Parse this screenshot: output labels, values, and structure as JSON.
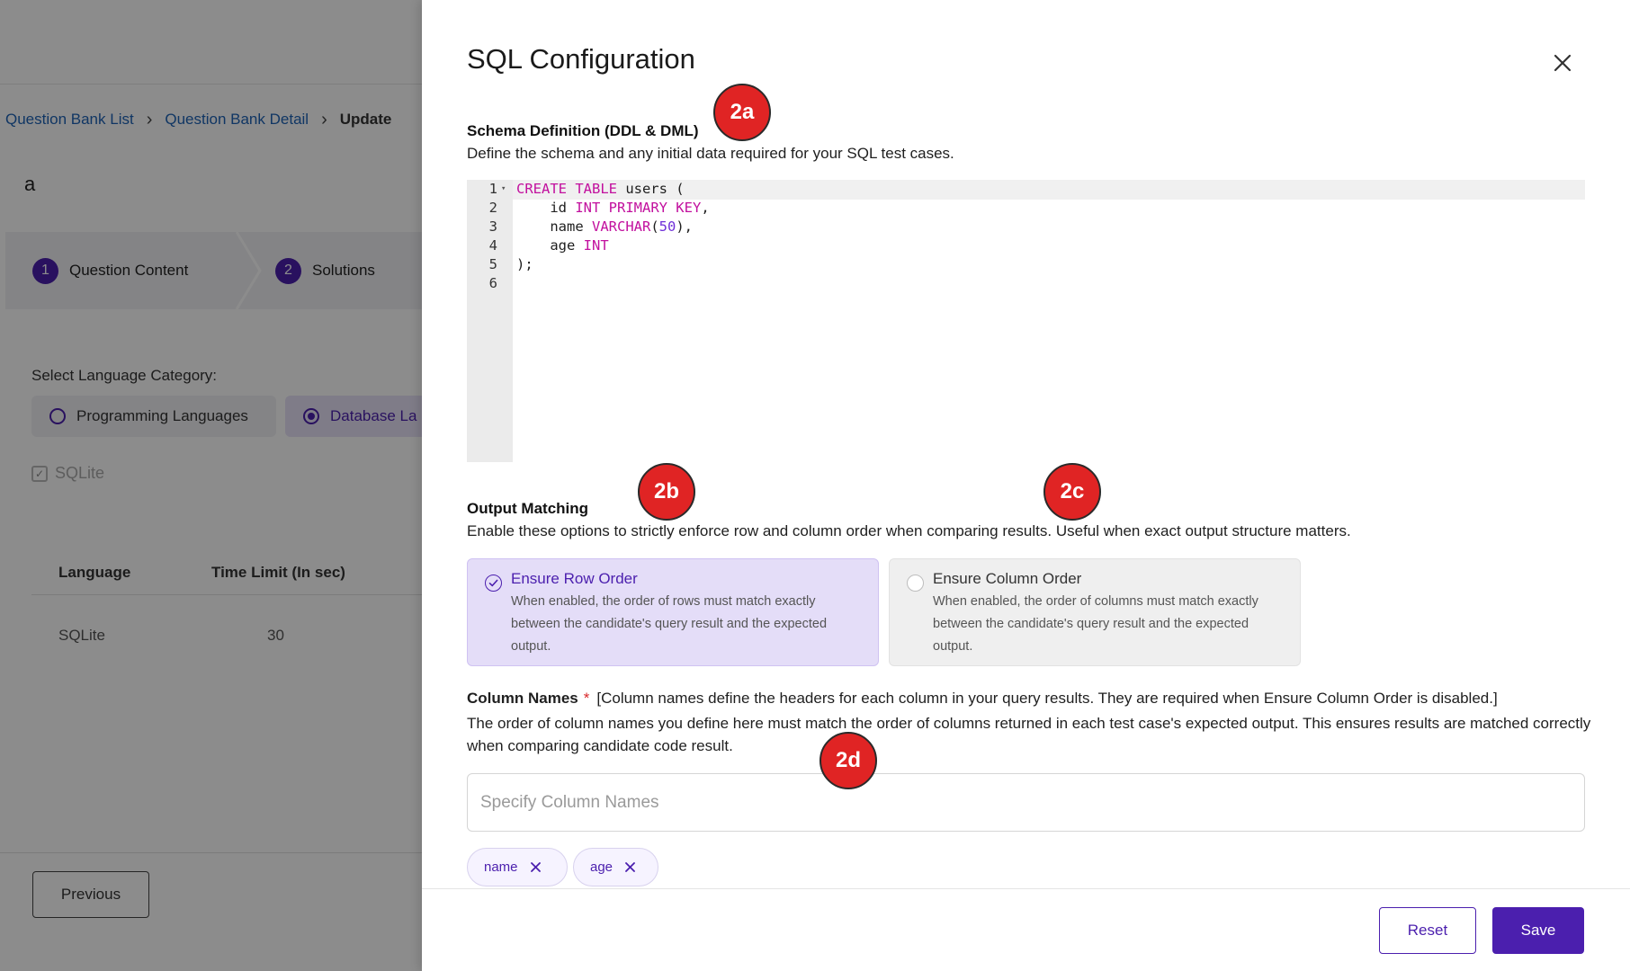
{
  "background": {
    "breadcrumb": [
      "Question Bank List",
      "Question Bank Detail",
      "Update"
    ],
    "page_letter": "a",
    "steps": [
      {
        "num": "1",
        "label": "Question Content"
      },
      {
        "num": "2",
        "label": "Solutions"
      }
    ],
    "lang_category_label": "Select Language Category:",
    "lang_options": [
      "Programming Languages",
      "Database La"
    ],
    "sqlite_label": "SQLite",
    "table": {
      "headers": [
        "Language",
        "Time Limit (In sec)"
      ],
      "row": [
        "SQLite",
        "30"
      ]
    },
    "previous_label": "Previous"
  },
  "drawer": {
    "title": "SQL Configuration",
    "schema": {
      "title": "Schema Definition (DDL & DML)",
      "desc": "Define the schema and any initial data required for your SQL test cases.",
      "line_numbers": [
        "1",
        "2",
        "3",
        "4",
        "5",
        "6"
      ],
      "code": {
        "l1_kw": "CREATE TABLE",
        "l1_rest": " users (",
        "l2_ident": "    id ",
        "l2_kw": "INT PRIMARY KEY",
        "l2_rest": ",",
        "l3_ident": "    name ",
        "l3_kw": "VARCHAR",
        "l3_open": "(",
        "l3_num": "50",
        "l3_rest": "),",
        "l4_ident": "    age ",
        "l4_kw": "INT",
        "l5": ");"
      }
    },
    "output_matching": {
      "title": "Output Matching",
      "desc": "Enable these options to strictly enforce row and column order when comparing results. Useful when exact output structure matters.",
      "row_order": {
        "title": "Ensure Row Order",
        "desc": "When enabled, the order of rows must match exactly between the candidate's query result and the expected output.",
        "checked": true
      },
      "column_order": {
        "title": "Ensure Column Order",
        "desc": "When enabled, the order of columns must match exactly between the candidate's query result and the expected output.",
        "checked": false
      }
    },
    "column_names": {
      "title": "Column Names",
      "required_mark": "*",
      "note": "[Column names define the headers for each column in your query results. They are required when Ensure Column Order is disabled.]",
      "desc": "The order of column names you define here must match the order of columns returned in each test case's expected output. This ensures results are matched correctly when comparing candidate code result.",
      "placeholder": "Specify Column Names",
      "value": "",
      "chips": [
        "name",
        "age"
      ]
    },
    "reset_label": "Reset",
    "save_label": "Save"
  },
  "markers": [
    "2a",
    "2b",
    "2c",
    "2d"
  ],
  "colors": {
    "accent": "#4b1fae",
    "link": "#1e63b6",
    "marker": "#e02424",
    "keyword": "#c2109e",
    "number": "#6f2fd8"
  }
}
